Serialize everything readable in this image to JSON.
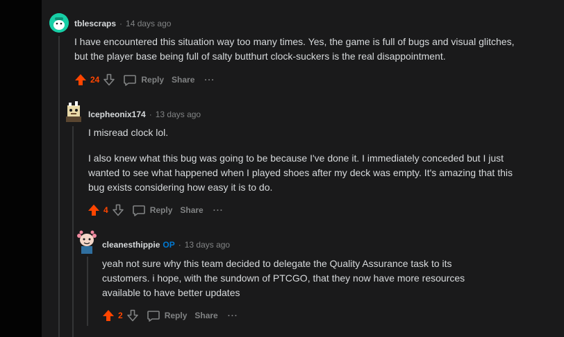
{
  "comments": [
    {
      "username": "tblescraps",
      "time": "14 days ago",
      "paragraphs": [
        "I have encountered this situation way too many times. Yes, the game is full of bugs and visual glitches, but the player base being full of salty butthurt clock-suckers is the real disappointment."
      ],
      "votes": "24",
      "reply_label": "Reply",
      "share_label": "Share",
      "more_label": "···"
    },
    {
      "username": "Icepheonix174",
      "time": "13 days ago",
      "paragraphs": [
        "I misread clock lol.",
        "I also knew what this bug was going to be because I've done it. I immediately conceded but I just wanted to see what happened when I played shoes after my deck was empty. It's amazing that this bug exists considering how easy it is to do."
      ],
      "votes": "4",
      "reply_label": "Reply",
      "share_label": "Share",
      "more_label": "···"
    },
    {
      "username": "cleanesthippie",
      "op_badge": "OP",
      "time": "13 days ago",
      "paragraphs": [
        "yeah not sure why this team decided to delegate the Quality Assurance task to its customers. i hope, with the sundown of PTCGO, that they now have more resources available to have better updates"
      ],
      "votes": "2",
      "reply_label": "Reply",
      "share_label": "Share",
      "more_label": "···"
    }
  ],
  "colors": {
    "background": "#030303",
    "panel": "#1a1a1b",
    "text": "#d7dadc",
    "muted": "#818384",
    "upvote": "#ff4500",
    "op": "#0079d3",
    "thread_line": "#343536"
  },
  "icons": [
    "avatar-tblescraps",
    "avatar-icepheonix174",
    "avatar-cleanesthippie",
    "upvote-arrow-icon",
    "downvote-arrow-icon",
    "comment-bubble-icon"
  ]
}
